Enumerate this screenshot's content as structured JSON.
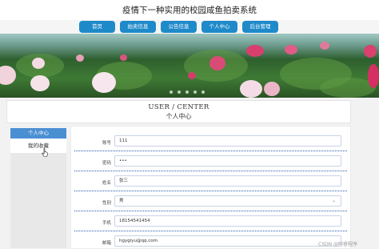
{
  "site": {
    "title": "疫情下一种实用的校园咸鱼拍卖系统"
  },
  "nav": [
    {
      "label": "首页"
    },
    {
      "label": "拍卖信息"
    },
    {
      "label": "公告信息"
    },
    {
      "label": "个人中心"
    },
    {
      "label": "后台管理"
    }
  ],
  "banner": {
    "slide_count": 5
  },
  "center": {
    "title_en": "USER / CENTER",
    "title_cn": "个人中心"
  },
  "sidebar": {
    "active": "个人中心",
    "items": [
      {
        "label": "我的收藏"
      }
    ]
  },
  "form": {
    "fields": [
      {
        "label": "账号",
        "value": "111"
      },
      {
        "label": "密码",
        "value": "•••"
      },
      {
        "label": "姓名",
        "value": "张三"
      },
      {
        "label": "性别",
        "value": "男"
      },
      {
        "label": "手机",
        "value": "18154541454"
      },
      {
        "label": "邮箱",
        "value": "hgygiyu@qq.com"
      }
    ]
  },
  "watermark": "CSDN @阿睿程序",
  "colors": {
    "accent": "#1f8ac9",
    "sidebar_active": "#4b8fd3",
    "divider": "#2a5db0"
  }
}
